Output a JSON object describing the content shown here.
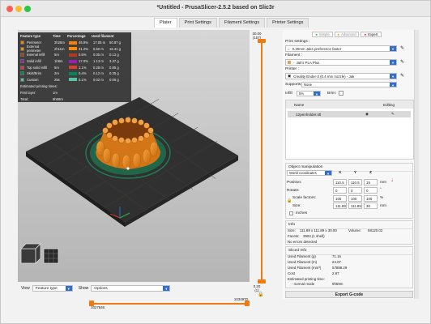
{
  "window": {
    "title": "*Untitled - PrusaSlicer-2.5.2 based on Slic3r"
  },
  "tabs": [
    {
      "label": "Plater",
      "active": true
    },
    {
      "label": "Print Settings",
      "active": false
    },
    {
      "label": "Filament Settings",
      "active": false
    },
    {
      "label": "Printer Settings",
      "active": false
    }
  ],
  "legend": {
    "headers": [
      "Feature type",
      "Time",
      "Percentage",
      "Used filament"
    ],
    "rows": [
      {
        "name": "Perimeter",
        "time": "3h25m",
        "pct": "46.9%",
        "len": "17.05 m",
        "weight": "50.87 g",
        "color": "#ff7f00"
      },
      {
        "name": "External perimeter",
        "time": "2h11m",
        "pct": "31.2%",
        "len": "5.50 m",
        "weight": "16.41 g",
        "color": "#ff8c00"
      },
      {
        "name": "Internal infill",
        "time": "5m",
        "pct": "0.6%",
        "len": "0.05 m",
        "weight": "0.13 g",
        "color": "#b23a1e"
      },
      {
        "name": "Solid infill",
        "time": "1h8m",
        "pct": "17.0%",
        "len": "1.13 m",
        "weight": "3.37 g",
        "color": "#9b1fb0"
      },
      {
        "name": "Top solid infill",
        "time": "5m",
        "pct": "1.1%",
        "len": "0.28 m",
        "weight": "0.85 g",
        "color": "#e33b2b"
      },
      {
        "name": "Skirt/Brim",
        "time": "2m",
        "pct": "0.4%",
        "len": "0.12 m",
        "weight": "0.35 g",
        "color": "#00885a"
      },
      {
        "name": "Custom",
        "time": "25s",
        "pct": "0.1%",
        "len": "0.02 m",
        "weight": "0.06 g",
        "color": "#57c4a6"
      }
    ],
    "estimated_label": "Estimated printing times:",
    "first_layer_label": "First layer:",
    "first_layer_value": "1m",
    "total_label": "Total:",
    "total_value": "9h59m"
  },
  "view_controls": {
    "view_label": "View",
    "view_value": "Feature type",
    "show_label": "Show",
    "show_value": "Options"
  },
  "horizontal_slider": {
    "top_value": "1034970",
    "bottom_value": "1027846"
  },
  "vertical_slider": {
    "top_value": "30.00",
    "top_sub": "(157)",
    "bottom_value": "0.20",
    "bottom_sub": "(1)"
  },
  "right_panel": {
    "mode_buttons": [
      "Simple",
      "Advanced",
      "Expert"
    ],
    "print_settings_label": "Print settings :",
    "print_settings_value": "0.20mm Jaks preference faster",
    "filament_label": "Filament :",
    "filament_value": "Jak's PLA Plus",
    "printer_label": "Printer :",
    "printer_value": "Creality Ender-3 (0.4 mm nozzle) - Jak",
    "supports_label": "Supports:",
    "supports_value": "None",
    "infill_label": "Infill:",
    "infill_value": "5%",
    "brim_label": "Brim:",
    "object_list_header_name": "Name",
    "object_list_header_editing": "Editing",
    "object_name": "12penholder.stl",
    "object_manipulation_title": "Object manipulation",
    "coords_value": "World coordinates",
    "axis_x": "X",
    "axis_y": "Y",
    "axis_z": "Z",
    "position_label": "Position:",
    "position": [
      "110.5",
      "110.5",
      "15"
    ],
    "rotate_label": "Rotate:",
    "rotate": [
      "0",
      "0",
      "0"
    ],
    "scale_label": "Scale factors:",
    "scale": [
      "100",
      "100",
      "100"
    ],
    "size_label": "Size:",
    "size": [
      "111.89",
      "111.89",
      "30"
    ],
    "unit_mm": "mm",
    "unit_deg": "°",
    "unit_pct": "%",
    "inches_label": "Inches",
    "info_title": "Info",
    "info_size_label": "Size:",
    "info_size_value": "111.89 x 111.89 x 30.00",
    "info_volume_label": "Volume:",
    "info_volume_value": "58120.02",
    "info_facets_label": "Facets:",
    "info_facets_value": "3904 (1 shell)",
    "info_errors": "No errors detected",
    "sliced_title": "Sliced Info",
    "sliced": [
      {
        "label": "Used Filament (g)",
        "value": "71.16"
      },
      {
        "label": "Used Filament (m)",
        "value": "24.07"
      },
      {
        "label": "Used Filament (mm³)",
        "value": "57888.29"
      },
      {
        "label": "Cost",
        "value": "2.87"
      }
    ],
    "est_label": "Estimated printing time:",
    "est_mode_label": "- normal mode",
    "est_value": "9h59m",
    "export_label": "Export G-code"
  },
  "colors": {
    "accent_blue": "#2f6fd3",
    "export_red": "#d02a2a",
    "slider_orange": "#ee7a12",
    "model_orange": "#ef8a1a"
  }
}
